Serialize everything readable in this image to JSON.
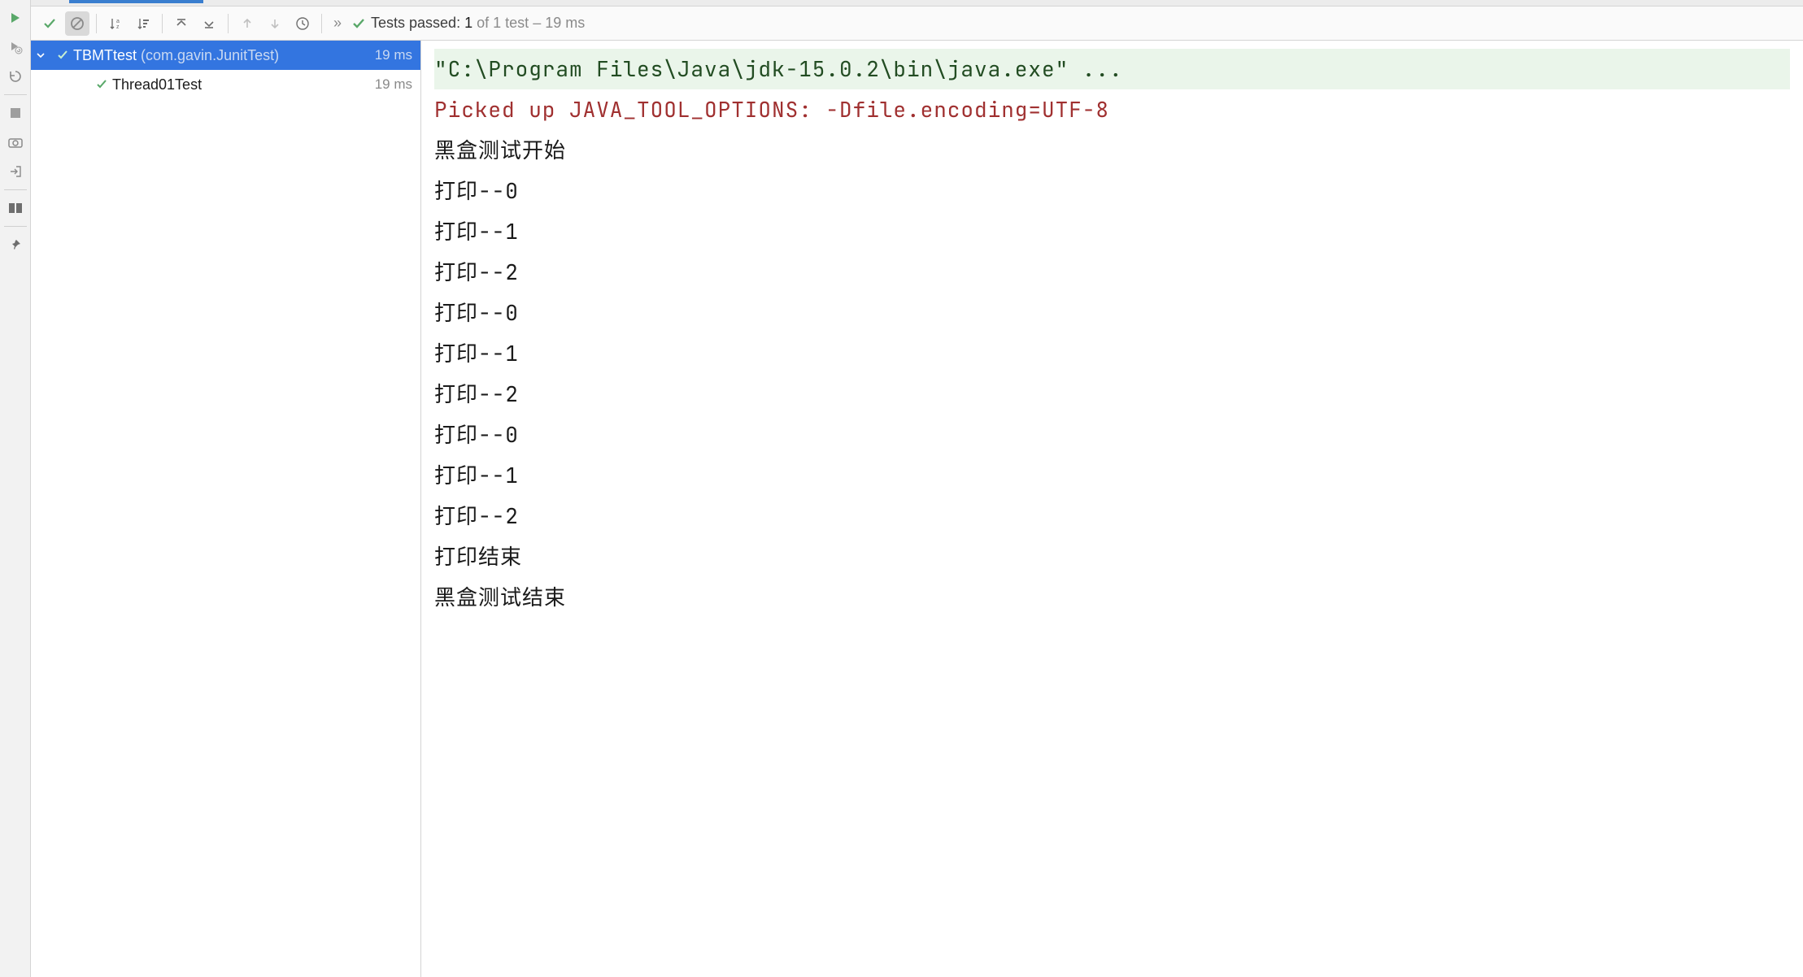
{
  "status": {
    "label": "Tests passed:",
    "passed": "1",
    "of": "of 1 test",
    "dash": "–",
    "duration": "19 ms"
  },
  "tree": {
    "root": {
      "name": "TBMTtest",
      "pkg": "(com.gavin.JunitTest)",
      "duration": "19 ms"
    },
    "child": {
      "name": "Thread01Test",
      "duration": "19 ms"
    }
  },
  "console": [
    {
      "cls": "cmd",
      "text": "\"C:\\Program Files\\Java\\jdk-15.0.2\\bin\\java.exe\" ..."
    },
    {
      "cls": "err",
      "text": "Picked up JAVA_TOOL_OPTIONS: -Dfile.encoding=UTF-8"
    },
    {
      "cls": "std",
      "text": ""
    },
    {
      "cls": "std",
      "text": "黑盒测试开始"
    },
    {
      "cls": "std",
      "text": "打印--0"
    },
    {
      "cls": "std",
      "text": "打印--1"
    },
    {
      "cls": "std",
      "text": "打印--2"
    },
    {
      "cls": "std",
      "text": "打印--0"
    },
    {
      "cls": "std",
      "text": "打印--1"
    },
    {
      "cls": "std",
      "text": "打印--2"
    },
    {
      "cls": "std",
      "text": "打印--0"
    },
    {
      "cls": "std",
      "text": "打印--1"
    },
    {
      "cls": "std",
      "text": "打印--2"
    },
    {
      "cls": "std",
      "text": "打印结束"
    },
    {
      "cls": "std",
      "text": "黑盒测试结束"
    }
  ],
  "chevrons": "»"
}
